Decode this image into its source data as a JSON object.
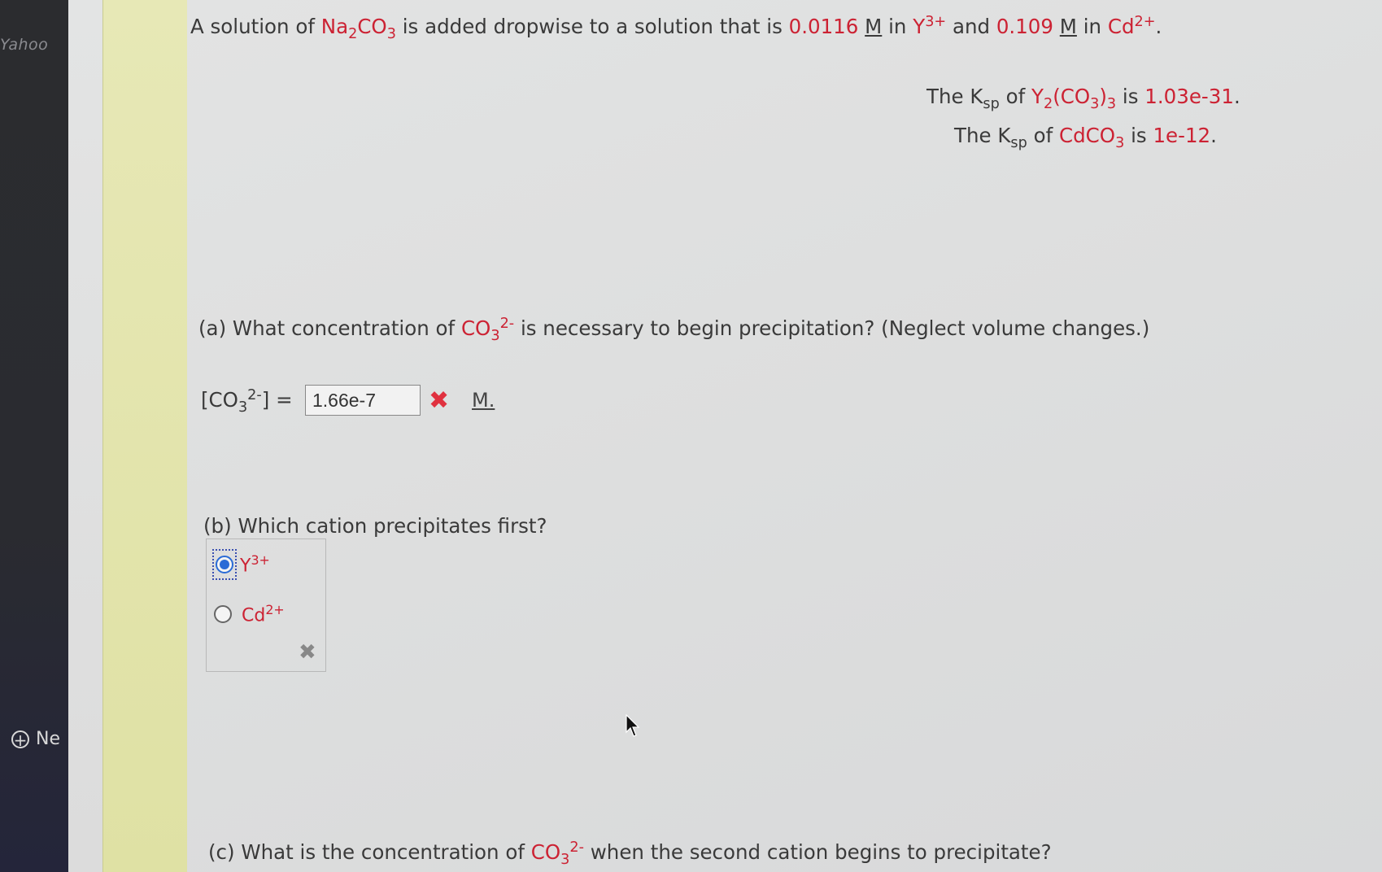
{
  "sidebar": {
    "brand": "Yahoo",
    "new_label": "Ne"
  },
  "problem": {
    "intro_pre": "A solution of ",
    "na2co3": {
      "a": "Na",
      "s1": "2",
      "b": "CO",
      "s2": "3"
    },
    "intro_mid1": " is added dropwise to a solution that is ",
    "conc_y": "0.0116",
    "unit_m": "M",
    "in1": " in ",
    "y": {
      "base": "Y",
      "charge": "3+"
    },
    "and": " and ",
    "conc_cd": "0.109",
    "in2": " in ",
    "cd": {
      "base": "Cd",
      "charge": "2+"
    },
    "period": "."
  },
  "ksp1": {
    "pre": "The K",
    "sub": "sp",
    "of": " of ",
    "compound": {
      "a": "Y",
      "s1": "2",
      "b": "(CO",
      "s2": "3",
      "c": ")",
      "s3": "3"
    },
    "is": " is ",
    "value": "1.03e-31",
    "end": "."
  },
  "ksp2": {
    "pre": "The K",
    "sub": "sp",
    "of": " of ",
    "compound": {
      "a": "CdCO",
      "s1": "3"
    },
    "is": " is ",
    "value": "1e-12",
    "end": "."
  },
  "part_a": {
    "q_pre": "(a) What concentration of ",
    "co": "CO",
    "co_sub": "3",
    "co_sup": "2-",
    "q_post": " is necessary to begin precipitation? (Neglect volume changes.)",
    "lhs_open": "[CO",
    "lhs_sub": "3",
    "lhs_sup": "2-",
    "lhs_close": "] =",
    "answer": "1.66e-7",
    "wrong_mark": "✖",
    "unit": "M."
  },
  "part_b": {
    "question": "(b) Which cation precipitates first?",
    "options": [
      {
        "base": "Y",
        "charge": "3+",
        "selected": true
      },
      {
        "base": "Cd",
        "charge": "2+",
        "selected": false
      }
    ],
    "wrong_mark": "✖"
  },
  "part_c": {
    "q_pre": "(c) What is the concentration of ",
    "co": "CO",
    "co_sub": "3",
    "co_sup": "2-",
    "q_post": " when the second cation begins to precipitate?"
  }
}
